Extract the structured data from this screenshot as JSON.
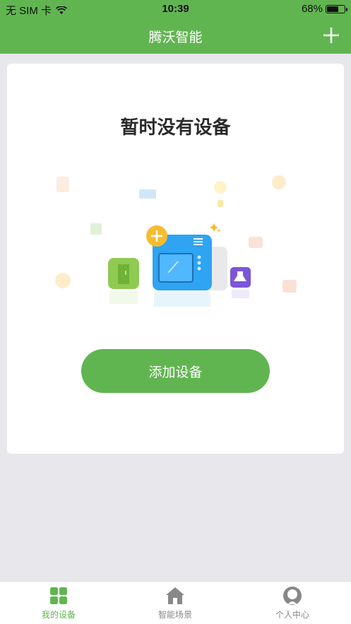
{
  "status_bar": {
    "carrier": "无 SIM 卡",
    "time": "10:39",
    "battery": "68%",
    "battery_level": 0.68
  },
  "header": {
    "title": "腾沃智能",
    "add_icon": "plus-icon"
  },
  "empty_state": {
    "title": "暂时没有设备",
    "button_label": "添加设备"
  },
  "tabs": [
    {
      "label": "我的设备",
      "icon": "grid-icon",
      "active": true
    },
    {
      "label": "智能场景",
      "icon": "home-icon",
      "active": false
    },
    {
      "label": "个人中心",
      "icon": "user-icon",
      "active": false
    }
  ],
  "colors": {
    "brand": "#61b551",
    "background": "#e8e8ec",
    "inactive": "#888888"
  }
}
